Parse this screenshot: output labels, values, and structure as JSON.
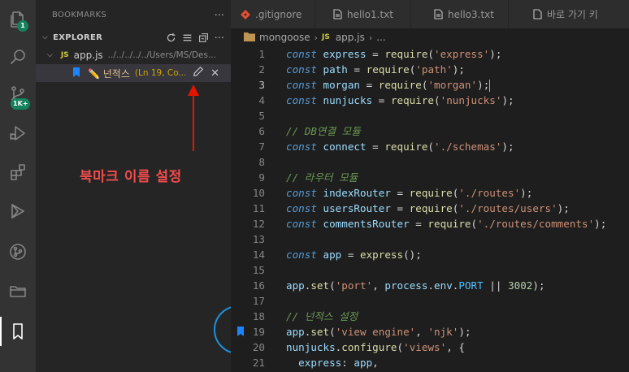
{
  "activity_bar": {
    "badges": {
      "source_control": "1",
      "extensions": "1K+"
    },
    "icons": [
      "files-icon",
      "search-icon",
      "source-control-icon",
      "run-debug-icon",
      "extensions-icon",
      "remote-icon",
      "git-graph-icon",
      "folder-icon",
      "bookmark-icon"
    ]
  },
  "sidebar": {
    "bookmarks_title": "BOOKMARKS",
    "bookmarks_more": "⋯",
    "explorer_title": "EXPLORER",
    "file": {
      "badge": "JS",
      "name": "app.js",
      "path": "../../../../../Users/MS/Des..."
    },
    "bookmark": {
      "label": "✏️ 넌적스",
      "location": "(Ln 19, Co..."
    }
  },
  "annotation": {
    "label": "북마크 이름 설정",
    "arrow_color": "#e51400",
    "circle_color": "#1e90d9"
  },
  "tabs": [
    {
      "label": ".gitignore",
      "icon": "git-icon"
    },
    {
      "label": "hello1.txt",
      "icon": "file-icon"
    },
    {
      "label": "hello3.txt",
      "icon": "file-icon"
    },
    {
      "label": "바로 가기 키",
      "icon": "file-icon"
    }
  ],
  "breadcrumb": {
    "folder": "mongoose",
    "file_badge": "JS",
    "file": "app.js",
    "more": "..."
  },
  "code": {
    "lines": [
      {
        "n": "1",
        "t": [
          [
            "k",
            "const"
          ],
          [
            "p",
            " "
          ],
          [
            "v",
            "express"
          ],
          [
            "o",
            " = "
          ],
          [
            "f",
            "require"
          ],
          [
            "p",
            "("
          ],
          [
            "s",
            "'express'"
          ],
          [
            "p",
            ");"
          ]
        ]
      },
      {
        "n": "2",
        "t": [
          [
            "k",
            "const"
          ],
          [
            "p",
            " "
          ],
          [
            "v",
            "path"
          ],
          [
            "o",
            " = "
          ],
          [
            "f",
            "require"
          ],
          [
            "p",
            "("
          ],
          [
            "s",
            "'path'"
          ],
          [
            "p",
            ");"
          ]
        ]
      },
      {
        "n": "3",
        "t": [
          [
            "k",
            "const"
          ],
          [
            "p",
            " "
          ],
          [
            "v",
            "morgan"
          ],
          [
            "o",
            " = "
          ],
          [
            "f",
            "require"
          ],
          [
            "p",
            "("
          ],
          [
            "s",
            "'morgan'"
          ],
          [
            "p",
            ");"
          ]
        ]
      },
      {
        "n": "4",
        "t": [
          [
            "k",
            "const"
          ],
          [
            "p",
            " "
          ],
          [
            "v",
            "nunjucks"
          ],
          [
            "o",
            " = "
          ],
          [
            "f",
            "require"
          ],
          [
            "p",
            "("
          ],
          [
            "s",
            "'nunjucks'"
          ],
          [
            "p",
            ");"
          ]
        ]
      },
      {
        "n": "5",
        "t": []
      },
      {
        "n": "6",
        "t": [
          [
            "c",
            "// DB연결 모듈"
          ]
        ]
      },
      {
        "n": "7",
        "t": [
          [
            "k",
            "const"
          ],
          [
            "p",
            " "
          ],
          [
            "v",
            "connect"
          ],
          [
            "o",
            " = "
          ],
          [
            "f",
            "require"
          ],
          [
            "p",
            "("
          ],
          [
            "s",
            "'./schemas'"
          ],
          [
            "p",
            ");"
          ]
        ]
      },
      {
        "n": "8",
        "t": []
      },
      {
        "n": "9",
        "t": [
          [
            "c",
            "// 라우터 모듈"
          ]
        ]
      },
      {
        "n": "10",
        "t": [
          [
            "k",
            "const"
          ],
          [
            "p",
            " "
          ],
          [
            "v",
            "indexRouter"
          ],
          [
            "o",
            " = "
          ],
          [
            "f",
            "require"
          ],
          [
            "p",
            "("
          ],
          [
            "s",
            "'./routes'"
          ],
          [
            "p",
            ");"
          ]
        ]
      },
      {
        "n": "11",
        "t": [
          [
            "k",
            "const"
          ],
          [
            "p",
            " "
          ],
          [
            "v",
            "usersRouter"
          ],
          [
            "o",
            " = "
          ],
          [
            "f",
            "require"
          ],
          [
            "p",
            "("
          ],
          [
            "s",
            "'./routes/users'"
          ],
          [
            "p",
            ");"
          ]
        ]
      },
      {
        "n": "12",
        "t": [
          [
            "k",
            "const"
          ],
          [
            "p",
            " "
          ],
          [
            "v",
            "commentsRouter"
          ],
          [
            "o",
            " = "
          ],
          [
            "f",
            "require"
          ],
          [
            "p",
            "("
          ],
          [
            "s",
            "'./routes/comments'"
          ],
          [
            "p",
            ");"
          ]
        ]
      },
      {
        "n": "13",
        "t": []
      },
      {
        "n": "14",
        "t": [
          [
            "k",
            "const"
          ],
          [
            "p",
            " "
          ],
          [
            "v",
            "app"
          ],
          [
            "o",
            " = "
          ],
          [
            "f",
            "express"
          ],
          [
            "p",
            "();"
          ]
        ]
      },
      {
        "n": "15",
        "t": []
      },
      {
        "n": "16",
        "t": [
          [
            "v",
            "app"
          ],
          [
            "p",
            "."
          ],
          [
            "f",
            "set"
          ],
          [
            "p",
            "("
          ],
          [
            "s",
            "'port'"
          ],
          [
            "p",
            ", "
          ],
          [
            "v",
            "process"
          ],
          [
            "p",
            "."
          ],
          [
            "v",
            "env"
          ],
          [
            "p",
            "."
          ],
          [
            "cn",
            "PORT"
          ],
          [
            "o",
            " || "
          ],
          [
            "n",
            "3002"
          ],
          [
            "p",
            ");"
          ]
        ]
      },
      {
        "n": "17",
        "t": []
      },
      {
        "n": "18",
        "t": [
          [
            "c",
            "// 넌적스 설정"
          ]
        ]
      },
      {
        "n": "19",
        "t": [
          [
            "v",
            "app"
          ],
          [
            "p",
            "."
          ],
          [
            "f",
            "set"
          ],
          [
            "p",
            "("
          ],
          [
            "s",
            "'view engine'"
          ],
          [
            "p",
            ", "
          ],
          [
            "s",
            "'njk'"
          ],
          [
            "p",
            ");"
          ]
        ]
      },
      {
        "n": "20",
        "t": [
          [
            "v",
            "nunjucks"
          ],
          [
            "p",
            "."
          ],
          [
            "f",
            "configure"
          ],
          [
            "p",
            "("
          ],
          [
            "s",
            "'views'"
          ],
          [
            "p",
            ", {"
          ]
        ]
      },
      {
        "n": "21",
        "t": [
          [
            "p",
            "  "
          ],
          [
            "v",
            "express"
          ],
          [
            "p",
            ": "
          ],
          [
            "v",
            "app"
          ],
          [
            "p",
            ","
          ]
        ]
      }
    ],
    "current_line": "3",
    "bookmark_line": "19"
  },
  "colors": {
    "accent": "#007acc",
    "bookmark": "#1a85ff",
    "annotation": "#f14c4c"
  }
}
